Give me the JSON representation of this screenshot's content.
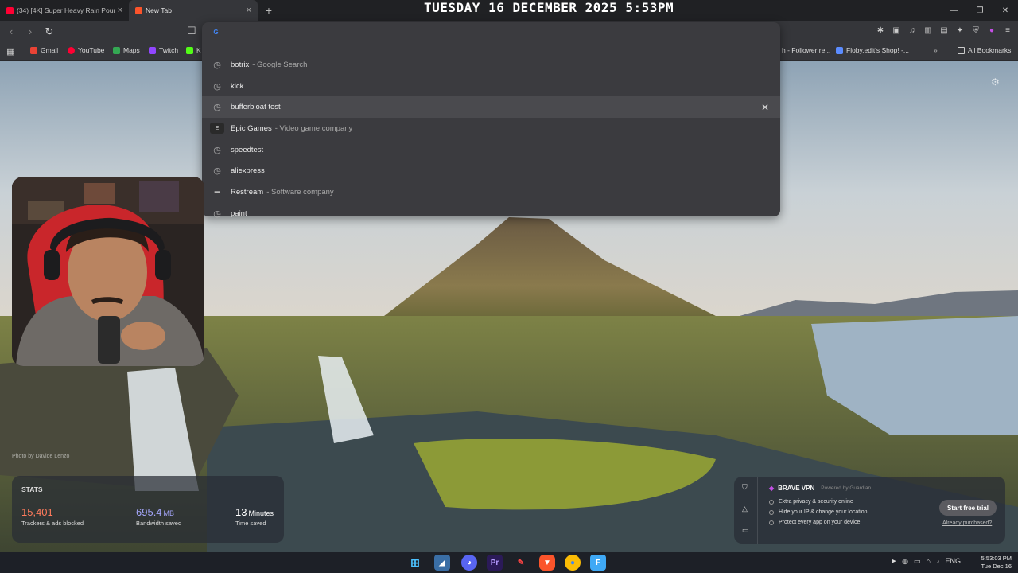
{
  "tabs": [
    {
      "label": "(34) [4K] Super Heavy Rain Pouri",
      "favicon_color": "#ff0033"
    },
    {
      "label": "New Tab",
      "favicon_color": "#fb542b"
    }
  ],
  "overlay_datetime": "TUESDAY 16 DECEMBER 2025 5:53PM",
  "bookmarks": [
    {
      "label": "Gmail",
      "color": "#ea4335"
    },
    {
      "label": "YouTube",
      "color": "#ff0033"
    },
    {
      "label": "Maps",
      "color": "#34a853"
    },
    {
      "label": "Twitch",
      "color": "#9146ff"
    },
    {
      "label": "K",
      "color": "#53fc18"
    },
    {
      "label": "h - Follower re...",
      "color": "#777777"
    },
    {
      "label": "Floby.edit's Shop! -...",
      "color": "#5b8cff"
    },
    {
      "label": "All Bookmarks",
      "color": "#cccccc"
    }
  ],
  "omnibox": {
    "suggestions": [
      {
        "text": "botrix",
        "desc": "- Google Search",
        "icon": "history-icon"
      },
      {
        "text": "kick",
        "desc": "",
        "icon": "history-icon"
      },
      {
        "text": "bufferbloat test",
        "desc": "",
        "icon": "history-icon"
      },
      {
        "text": "Epic Games",
        "desc": "- Video game company",
        "icon": "epic-games-logo"
      },
      {
        "text": "speedtest",
        "desc": "",
        "icon": "history-icon"
      },
      {
        "text": "aliexpress",
        "desc": "",
        "icon": "history-icon"
      },
      {
        "text": "Restream",
        "desc": "- Software company",
        "icon": "restream-logo"
      },
      {
        "text": "paint",
        "desc": "",
        "icon": "history-icon"
      }
    ]
  },
  "photo_credit": "Photo by Davide Lenzo",
  "stats": {
    "header": "STATS",
    "trackers": {
      "value": "15,401",
      "caption": "Trackers & ads blocked",
      "color": "#ff7b5c"
    },
    "bandwidth": {
      "value": "695.4",
      "unit": "MB",
      "caption": "Bandwidth saved",
      "color": "#a2a4f7"
    },
    "time": {
      "value": "13",
      "unit": "Minutes",
      "caption": "Time saved",
      "color": "#ffffff"
    }
  },
  "vpn": {
    "title": "BRAVE VPN",
    "powered": "Powered by Guardian",
    "features": [
      "Extra privacy & security online",
      "Hide your IP & change your location",
      "Protect every app on your device"
    ],
    "cta": "Start free trial",
    "already": "Already purchased?"
  },
  "taskbar": {
    "time": "5:53:03 PM",
    "date": "Tue Dec 16",
    "lang": "ENG"
  }
}
